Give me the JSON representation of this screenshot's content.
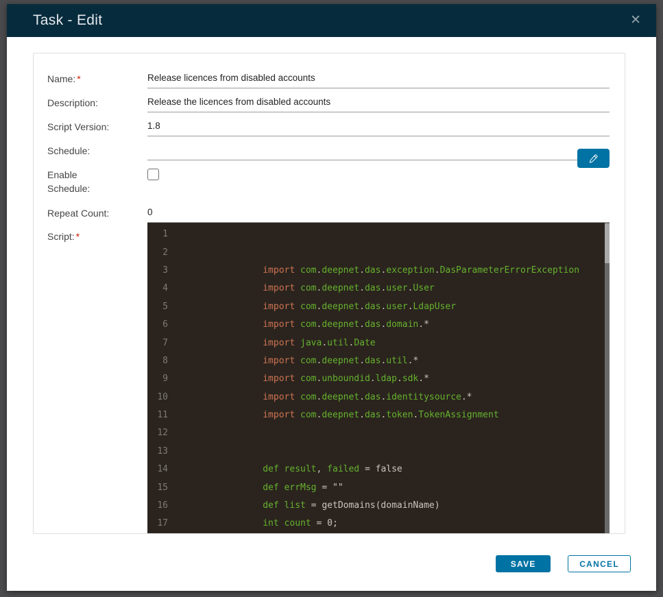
{
  "dialog": {
    "title": "Task - Edit",
    "close_glyph": "✕"
  },
  "colors": {
    "page_bg": "#4b4b4d",
    "header_bg": "#062b3c",
    "accent": "#0072a3",
    "red": "#c92100",
    "editor_bg": "#2b241e",
    "line_number": "#7d7a74",
    "code_green": "#65b22e",
    "code_orange": "#cd7352",
    "code_gray": "#c9c5bd"
  },
  "form": {
    "required_marker": "*",
    "fields": {
      "name": {
        "label": "Name:",
        "required": true,
        "value": "Release licences from disabled accounts"
      },
      "description": {
        "label": "Description:",
        "value": "Release the licences from disabled accounts"
      },
      "script_version": {
        "label": "Script Version:",
        "value": "1.8"
      },
      "schedule": {
        "label": "Schedule:",
        "value": ""
      },
      "enable_schedule": {
        "label": "Enable Schedule:",
        "checked": false
      },
      "repeat_count": {
        "label": "Repeat Count:",
        "value": "0"
      },
      "script": {
        "label": "Script:",
        "required": true
      }
    }
  },
  "editor": {
    "indent": "                ",
    "lines": [
      {
        "n": "1",
        "tokens": []
      },
      {
        "n": "2",
        "tokens": []
      },
      {
        "n": "3",
        "tokens": [
          [
            "w",
            "                "
          ],
          [
            "k",
            "import"
          ],
          [
            "w",
            " "
          ],
          [
            "g",
            "com"
          ],
          [
            "w",
            "."
          ],
          [
            "g",
            "deepnet"
          ],
          [
            "w",
            "."
          ],
          [
            "g",
            "das"
          ],
          [
            "w",
            "."
          ],
          [
            "g",
            "exception"
          ],
          [
            "w",
            "."
          ],
          [
            "g",
            "DasParameterErrorException"
          ]
        ]
      },
      {
        "n": "4",
        "tokens": [
          [
            "w",
            "                "
          ],
          [
            "k",
            "import"
          ],
          [
            "w",
            " "
          ],
          [
            "g",
            "com"
          ],
          [
            "w",
            "."
          ],
          [
            "g",
            "deepnet"
          ],
          [
            "w",
            "."
          ],
          [
            "g",
            "das"
          ],
          [
            "w",
            "."
          ],
          [
            "g",
            "user"
          ],
          [
            "w",
            "."
          ],
          [
            "g",
            "User"
          ]
        ]
      },
      {
        "n": "5",
        "tokens": [
          [
            "w",
            "                "
          ],
          [
            "k",
            "import"
          ],
          [
            "w",
            " "
          ],
          [
            "g",
            "com"
          ],
          [
            "w",
            "."
          ],
          [
            "g",
            "deepnet"
          ],
          [
            "w",
            "."
          ],
          [
            "g",
            "das"
          ],
          [
            "w",
            "."
          ],
          [
            "g",
            "user"
          ],
          [
            "w",
            "."
          ],
          [
            "g",
            "LdapUser"
          ]
        ]
      },
      {
        "n": "6",
        "tokens": [
          [
            "w",
            "                "
          ],
          [
            "k",
            "import"
          ],
          [
            "w",
            " "
          ],
          [
            "g",
            "com"
          ],
          [
            "w",
            "."
          ],
          [
            "g",
            "deepnet"
          ],
          [
            "w",
            "."
          ],
          [
            "g",
            "das"
          ],
          [
            "w",
            "."
          ],
          [
            "g",
            "domain"
          ],
          [
            "w",
            ".*"
          ]
        ]
      },
      {
        "n": "7",
        "tokens": [
          [
            "w",
            "                "
          ],
          [
            "k",
            "import"
          ],
          [
            "w",
            " "
          ],
          [
            "g",
            "java"
          ],
          [
            "w",
            "."
          ],
          [
            "g",
            "util"
          ],
          [
            "w",
            "."
          ],
          [
            "g",
            "Date"
          ]
        ]
      },
      {
        "n": "8",
        "tokens": [
          [
            "w",
            "                "
          ],
          [
            "k",
            "import"
          ],
          [
            "w",
            " "
          ],
          [
            "g",
            "com"
          ],
          [
            "w",
            "."
          ],
          [
            "g",
            "deepnet"
          ],
          [
            "w",
            "."
          ],
          [
            "g",
            "das"
          ],
          [
            "w",
            "."
          ],
          [
            "g",
            "util"
          ],
          [
            "w",
            ".*"
          ]
        ]
      },
      {
        "n": "9",
        "tokens": [
          [
            "w",
            "                "
          ],
          [
            "k",
            "import"
          ],
          [
            "w",
            " "
          ],
          [
            "g",
            "com"
          ],
          [
            "w",
            "."
          ],
          [
            "g",
            "unboundid"
          ],
          [
            "w",
            "."
          ],
          [
            "g",
            "ldap"
          ],
          [
            "w",
            "."
          ],
          [
            "g",
            "sdk"
          ],
          [
            "w",
            ".*"
          ]
        ]
      },
      {
        "n": "10",
        "tokens": [
          [
            "w",
            "                "
          ],
          [
            "k",
            "import"
          ],
          [
            "w",
            " "
          ],
          [
            "g",
            "com"
          ],
          [
            "w",
            "."
          ],
          [
            "g",
            "deepnet"
          ],
          [
            "w",
            "."
          ],
          [
            "g",
            "das"
          ],
          [
            "w",
            "."
          ],
          [
            "g",
            "identitysource"
          ],
          [
            "w",
            ".*"
          ]
        ]
      },
      {
        "n": "11",
        "tokens": [
          [
            "w",
            "                "
          ],
          [
            "k",
            "import"
          ],
          [
            "w",
            " "
          ],
          [
            "g",
            "com"
          ],
          [
            "w",
            "."
          ],
          [
            "g",
            "deepnet"
          ],
          [
            "w",
            "."
          ],
          [
            "g",
            "das"
          ],
          [
            "w",
            "."
          ],
          [
            "g",
            "token"
          ],
          [
            "w",
            "."
          ],
          [
            "g",
            "TokenAssignment"
          ]
        ]
      },
      {
        "n": "12",
        "tokens": []
      },
      {
        "n": "13",
        "tokens": []
      },
      {
        "n": "14",
        "tokens": [
          [
            "w",
            "                "
          ],
          [
            "g",
            "def"
          ],
          [
            "w",
            " "
          ],
          [
            "g",
            "result"
          ],
          [
            "w",
            ", "
          ],
          [
            "g",
            "failed"
          ],
          [
            "w",
            " = false"
          ]
        ]
      },
      {
        "n": "15",
        "tokens": [
          [
            "w",
            "                "
          ],
          [
            "g",
            "def"
          ],
          [
            "w",
            " "
          ],
          [
            "g",
            "errMsg"
          ],
          [
            "w",
            " = \"\""
          ]
        ]
      },
      {
        "n": "16",
        "tokens": [
          [
            "w",
            "                "
          ],
          [
            "g",
            "def"
          ],
          [
            "w",
            " "
          ],
          [
            "g",
            "list"
          ],
          [
            "w",
            " = getDomains(domainName)"
          ]
        ]
      },
      {
        "n": "17",
        "tokens": [
          [
            "w",
            "                "
          ],
          [
            "g",
            "int"
          ],
          [
            "w",
            " "
          ],
          [
            "g",
            "count"
          ],
          [
            "w",
            " = 0;"
          ]
        ]
      }
    ]
  },
  "footer": {
    "save_label": "SAVE",
    "cancel_label": "CANCEL"
  }
}
